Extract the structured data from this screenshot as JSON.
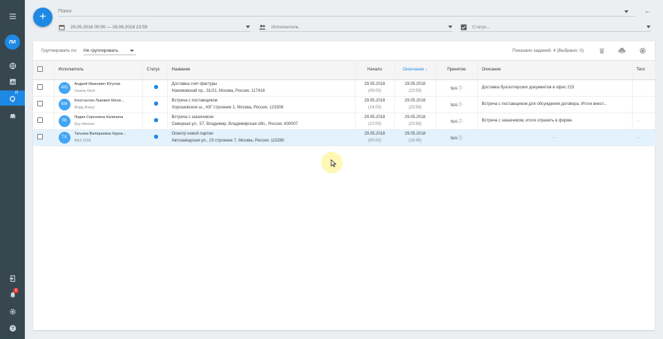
{
  "sidebar": {
    "menu_icon": "menu-icon",
    "avatar_initials": "ЛИ",
    "items": [
      "globe-icon",
      "reports-icon",
      "tasks-icon",
      "car-icon"
    ],
    "bottom": [
      "logout-icon",
      "bell-icon",
      "gear-icon",
      "help-icon"
    ],
    "notifications_count": "2",
    "tasks_sup": "R"
  },
  "header": {
    "add_label": "+",
    "search_placeholder": "Поиск",
    "date_range": "29.05.2018 00:00 — 29.06.2018 23:59",
    "executor_placeholder": "Исполнитель",
    "status_placeholder": "Статус..."
  },
  "toolbar": {
    "group_label": "Группировать по:",
    "group_value": "Не группировать",
    "shown_text": "Показано заданий: 4 (Выбрано: 0)"
  },
  "table": {
    "columns": {
      "executor": "Исполнитель",
      "status": "Статус",
      "title": "Название",
      "start": "Начало",
      "end": "Окончание",
      "accepted": "Принятие",
      "description": "Описание",
      "tags": "Теги"
    },
    "rows": [
      {
        "initials": "АЮ",
        "name": "Андрей Иванович Югулов",
        "vehicle": "Газель Next",
        "title": "Доставка счет-фактуры",
        "address": "Нахимовский пр., 31/21, Москва, Россия, 117418",
        "start_date": "29.05.2018",
        "start_time": "(09:00)",
        "end_date": "29.05.2018",
        "end_time": "(23:59)",
        "accepted": "N/A",
        "description": "Доставка бухгалтерских документов в офис 215",
        "tags": ""
      },
      {
        "initials": "КМ",
        "name": "Константин Львович Мели...",
        "vehicle": "Форд Фокус",
        "title": "Встреча с поставщиком",
        "address": "Хорошевское ш., 43Г строение 1, Москва, Россия, 123308",
        "start_date": "29.05.2018",
        "start_time": "(14:00)",
        "end_date": "29.05.2018",
        "end_time": "(23:59)",
        "accepted": "N/A",
        "description": "Встреча с поставщиком для обсуждения договора. Итоги внест...",
        "tags": ""
      },
      {
        "initials": "ЛК",
        "name": "Лидия Сергеевна Калинина",
        "vehicle": "Дэу Нексия",
        "title": "Встреча с заказчиком",
        "address": "Северная ул., 57, Владимир, Владимирская обл., Россия, 600007",
        "start_date": "29.05.2018",
        "start_time": "(10:00)",
        "end_date": "29.05.2018",
        "end_time": "(23:59)",
        "accepted": "N/A",
        "description": "Встреча с заказчиком, итоги отразить в форме.",
        "tags": "..."
      },
      {
        "initials": "ТХ",
        "name": "Татьяна Валерьевна Хруни...",
        "vehicle": "ВАЗ 2106",
        "title": "Осмотр новой партии",
        "address": "Автозаводская ул., 23 строение 7, Москва, Россия, 115280",
        "start_date": "29.05.2018",
        "start_time": "(00:00)",
        "end_date": "29.05.2018",
        "end_time": "(16:45)",
        "accepted": "N/A",
        "description": "...",
        "tags": "..."
      }
    ]
  },
  "colors": {
    "accent": "#1e88e5",
    "sidebar": "#37474f",
    "selected_row": "#e3f2fd"
  }
}
